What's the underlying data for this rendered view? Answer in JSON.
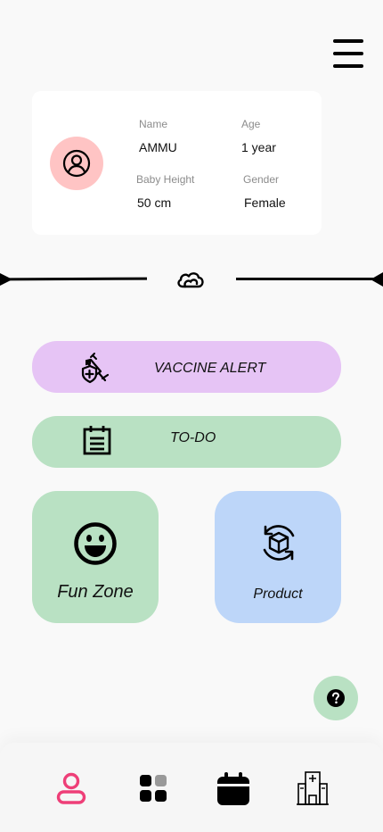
{
  "header": {
    "menu_icon": "hamburger-menu-icon"
  },
  "profile": {
    "avatar_icon": "user-circle-icon",
    "name_label": "Name",
    "name_value": "AMMU",
    "age_label": "Age",
    "age_value": "1 year",
    "height_label": "Baby Height",
    "height_value": "50 cm",
    "gender_label": "Gender",
    "gender_value": "Female"
  },
  "divider": {
    "icon": "clouds-icon"
  },
  "actions": {
    "vaccine": {
      "label": "VACCINE ALERT",
      "icon": "syringe-shield-icon",
      "color": "#e6c4f5"
    },
    "todo": {
      "label": "TO-DO",
      "icon": "calendar-notepad-icon",
      "color": "#b9e1c3"
    }
  },
  "tiles": {
    "fun_zone": {
      "label": "Fun Zone",
      "icon": "smiley-face-icon",
      "color": "#b9e1c3"
    },
    "product": {
      "label": "Product",
      "icon": "box-refresh-icon",
      "color": "#bdd6f9"
    }
  },
  "help": {
    "icon": "question-mark-icon"
  },
  "bottom_nav": {
    "items": [
      {
        "name": "profile",
        "icon": "user-icon",
        "active": true,
        "color": "#ee3f78"
      },
      {
        "name": "dashboard",
        "icon": "grid-icon",
        "active": false
      },
      {
        "name": "calendar",
        "icon": "calendar-icon",
        "active": false
      },
      {
        "name": "hospital",
        "icon": "hospital-icon",
        "active": false
      }
    ]
  }
}
